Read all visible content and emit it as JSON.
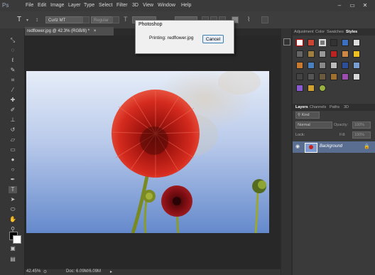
{
  "app": {
    "logo": "Ps",
    "menu": [
      "File",
      "Edit",
      "Image",
      "Layer",
      "Type",
      "Select",
      "Filter",
      "3D",
      "View",
      "Window",
      "Help"
    ],
    "window_controls": [
      "–",
      "▭",
      "✕"
    ]
  },
  "options_bar": {
    "tool_glyph": "T",
    "font_family": "Curlz MT",
    "font_style": "Regular"
  },
  "document": {
    "tab_label": "redflower.jpg @ 42.3% (RGB/8) *",
    "tab_close": "×"
  },
  "status_bar": {
    "zoom": "42.45%",
    "doc_info": "Doc: 6.09M/6.09M"
  },
  "dialog": {
    "title": "Photoshop",
    "message": "Printing: redflower.jpg",
    "cancel_label": "Cancel"
  },
  "panels": {
    "top_tabs": [
      "Adjustment",
      "Color",
      "Swatches",
      "Styles"
    ],
    "layers_tabs": [
      "Layers",
      "Channels",
      "Paths",
      "3D"
    ],
    "kind_label": "Kind",
    "blend_mode": "Normal",
    "opacity_label": "Opacity:",
    "opacity_value": "100%",
    "lock_label": "Lock:",
    "fill_label": "Fill:",
    "fill_value": "100%",
    "layer_name": "Background"
  },
  "colors": {
    "sky_top": "#e4ebf7",
    "sky_bottom": "#6d8fd0",
    "flower_red": "#c5241c",
    "dialog_button_border": "#3c7fb1"
  },
  "toolbar_icons": [
    "move-icon",
    "marquee-icon",
    "lasso-icon",
    "quick-select-icon",
    "crop-icon",
    "eyedropper-icon",
    "healing-icon",
    "brush-icon",
    "clone-stamp-icon",
    "history-brush-icon",
    "eraser-icon",
    "gradient-icon",
    "blur-icon",
    "dodge-icon",
    "pen-icon",
    "type-icon",
    "path-select-icon",
    "shape-icon",
    "hand-icon",
    "zoom-icon"
  ]
}
